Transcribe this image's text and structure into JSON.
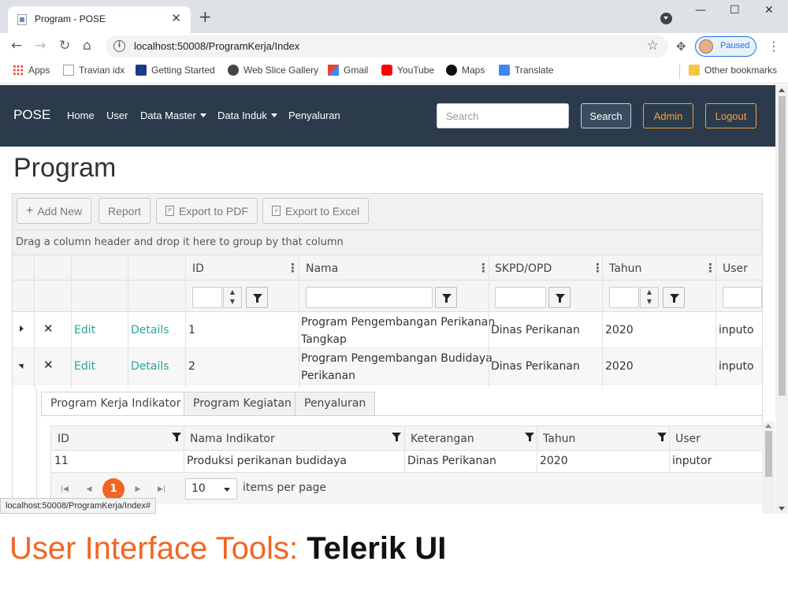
{
  "browser": {
    "tab_title": "Program - POSE",
    "url": "localhost:50008/ProgramKerja/Index",
    "profile_status": "Paused",
    "bookmarks": [
      "Apps",
      "Travian idx",
      "Getting Started",
      "Web Slice Gallery",
      "Gmail",
      "YouTube",
      "Maps",
      "Translate"
    ],
    "other_bookmarks": "Other bookmarks",
    "status_url": "localhost:50008/ProgramKerja/Index#"
  },
  "navbar": {
    "brand": "POSE",
    "links": [
      "Home",
      "User",
      "Data Master",
      "Data Induk",
      "Penyaluran"
    ],
    "search_placeholder": "Search",
    "search_button": "Search",
    "admin_button": "Admin",
    "logout_button": "Logout"
  },
  "page": {
    "title": "Program"
  },
  "grid": {
    "toolbar": {
      "add_new": "Add New",
      "report": "Report",
      "export_pdf": "Export to PDF",
      "export_excel": "Export to Excel"
    },
    "group_hint": "Drag a column header and drop it here to group by that column",
    "columns": [
      "ID",
      "Nama",
      "SKPD/OPD",
      "Tahun",
      "User"
    ],
    "rows": [
      {
        "edit": "Edit",
        "details": "Details",
        "id": "1",
        "nama_line1": "Program Pengembangan Perikanan",
        "nama_line2": "Tangkap",
        "skpd": "Dinas Perikanan",
        "tahun": "2020",
        "user": "inputo"
      },
      {
        "edit": "Edit",
        "details": "Details",
        "id": "2",
        "nama_line1": "Program Pengembangan Budidaya",
        "nama_line2": "Perikanan",
        "skpd": "Dinas Perikanan",
        "tahun": "2020",
        "user": "inputo"
      }
    ],
    "detail": {
      "tabs": [
        "Program Kerja Indikator",
        "Program Kegiatan",
        "Penyaluran"
      ],
      "columns": [
        "ID",
        "Nama Indikator",
        "Keterangan",
        "Tahun",
        "User"
      ],
      "row": {
        "id": "11",
        "nama": "Produksi perikanan budidaya",
        "keterangan": "Dinas Perikanan",
        "tahun": "2020",
        "user": "inputor"
      },
      "pager": {
        "current_page": "1",
        "page_size": "10",
        "label": "items per page"
      }
    }
  },
  "caption": {
    "part1": "User Interface Tools: ",
    "part2": "Telerik UI"
  },
  "colors": {
    "navbar": "#2b3b4b",
    "accent_orange": "#f26522",
    "link_teal": "#26a69a"
  }
}
